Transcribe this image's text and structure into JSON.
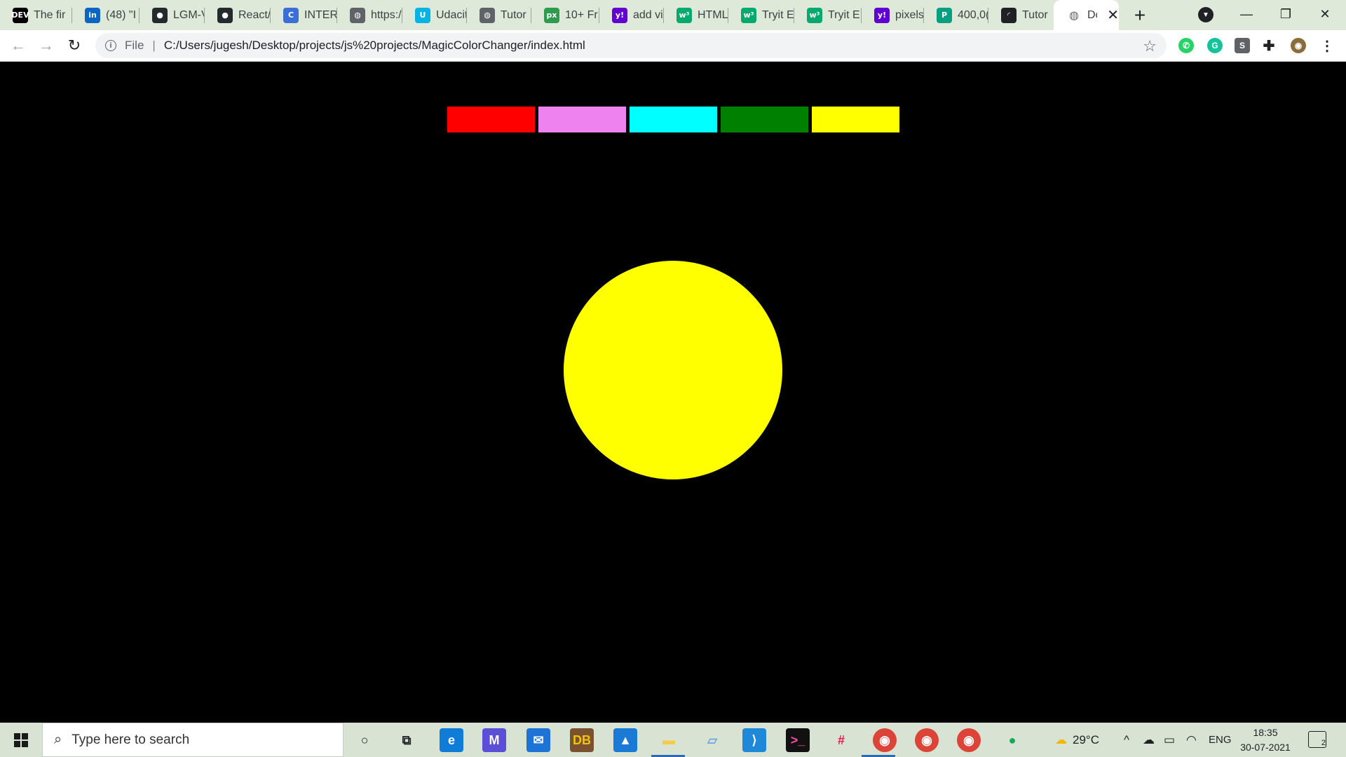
{
  "browser": {
    "tabs": [
      {
        "label": "The fir",
        "icon": "dev-icon",
        "favicon_text": "DEV",
        "favicon_color": "#000000"
      },
      {
        "label": "(48) \"I",
        "icon": "linkedin-icon",
        "favicon_text": "in",
        "favicon_color": "#0a66c2"
      },
      {
        "label": "LGM-V",
        "icon": "github-icon",
        "favicon_text": "●",
        "favicon_color": "#24292e"
      },
      {
        "label": "React/",
        "icon": "github-icon",
        "favicon_text": "●",
        "favicon_color": "#24292e"
      },
      {
        "label": "INTER",
        "icon": "c-icon",
        "favicon_text": "C",
        "favicon_color": "#3b6fd6"
      },
      {
        "label": "https:/",
        "icon": "globe-icon",
        "favicon_text": "◍",
        "favicon_color": "#5f6368"
      },
      {
        "label": "Udacit",
        "icon": "udacity-icon",
        "favicon_text": "U",
        "favicon_color": "#02b3e4"
      },
      {
        "label": "Tutor",
        "icon": "globe-icon",
        "favicon_text": "◍",
        "favicon_color": "#5f6368"
      },
      {
        "label": "10+ Fr",
        "icon": "px-icon",
        "favicon_text": "px",
        "favicon_color": "#2e9b4f"
      },
      {
        "label": "add vi",
        "icon": "yahoo-icon",
        "favicon_text": "y!",
        "favicon_color": "#6001d2"
      },
      {
        "label": "HTML",
        "icon": "w3schools-icon",
        "favicon_text": "w³",
        "favicon_color": "#04aa6d"
      },
      {
        "label": "Tryit E",
        "icon": "w3schools-icon",
        "favicon_text": "w³",
        "favicon_color": "#04aa6d"
      },
      {
        "label": "Tryit E",
        "icon": "w3schools-icon",
        "favicon_text": "w³",
        "favicon_color": "#04aa6d"
      },
      {
        "label": "pixels",
        "icon": "yahoo-icon",
        "favicon_text": "y!",
        "favicon_color": "#6001d2"
      },
      {
        "label": "400,0(",
        "icon": "pexels-icon",
        "favicon_text": "P",
        "favicon_color": "#05a081"
      },
      {
        "label": "Tutor",
        "icon": "loading-icon",
        "favicon_text": "◜",
        "favicon_color": "#202124"
      }
    ],
    "active_tab": {
      "label": "Dc",
      "icon": "globe-icon",
      "close": "✕"
    },
    "new_tab": "+",
    "window_controls": {
      "minimize": "—",
      "restore": "❐",
      "close": "✕"
    },
    "address": {
      "scheme_label": "File",
      "divider": "|",
      "url": "C:/Users/jugesh/Desktop/projects/js%20projects/MagicColorChanger/index.html",
      "info_glyph": "i",
      "bookmark": "☆"
    },
    "nav": {
      "back": "←",
      "forward": "→",
      "reload": "↻"
    },
    "extensions": [
      {
        "name": "whatsapp-icon",
        "glyph": "✆",
        "color": "#25d366"
      },
      {
        "name": "grammarly-icon",
        "glyph": "G",
        "color": "#15c39a"
      },
      {
        "name": "s-extension-icon",
        "glyph": "S",
        "color": "#5f6368"
      },
      {
        "name": "puzzle-icon",
        "glyph": "✚",
        "color": "#202124"
      },
      {
        "name": "avatar",
        "glyph": "◉",
        "color": "#8a6d3b"
      },
      {
        "name": "more-icon",
        "glyph": "⋮",
        "color": "#202124"
      }
    ]
  },
  "page": {
    "background": "#000000",
    "swatches": [
      {
        "name": "red",
        "color": "#ff0000"
      },
      {
        "name": "violet",
        "color": "#ee82ee"
      },
      {
        "name": "cyan",
        "color": "#00ffff"
      },
      {
        "name": "green",
        "color": "#008000"
      },
      {
        "name": "yellow",
        "color": "#ffff00"
      }
    ],
    "circle_color": "#ffff00"
  },
  "taskbar": {
    "search_placeholder": "Type here to search",
    "apps": [
      {
        "name": "cortana-icon",
        "glyph": "○",
        "color": "#202124",
        "bg": "transparent"
      },
      {
        "name": "task-view-icon",
        "glyph": "⧉",
        "color": "#202124",
        "bg": "transparent"
      },
      {
        "name": "edge-icon",
        "glyph": "e",
        "color": "#ffffff",
        "bg": "#0f7cd8"
      },
      {
        "name": "vs-icon",
        "glyph": "M",
        "color": "#ffffff",
        "bg": "#5b4fd8"
      },
      {
        "name": "mail-icon",
        "glyph": "✉",
        "color": "#ffffff",
        "bg": "#1e73d6"
      },
      {
        "name": "dosbox-icon",
        "glyph": "DB",
        "color": "#f1c40f",
        "bg": "#7a5230"
      },
      {
        "name": "photos-icon",
        "glyph": "▲",
        "color": "#ffffff",
        "bg": "#1b7ad6"
      },
      {
        "name": "file-explorer-icon",
        "glyph": "▬",
        "color": "#f7c948",
        "bg": "transparent"
      },
      {
        "name": "notepad-icon",
        "glyph": "▱",
        "color": "#6fa8dc",
        "bg": "transparent"
      },
      {
        "name": "vscode-icon",
        "glyph": "⟩",
        "color": "#ffffff",
        "bg": "#1f88d8"
      },
      {
        "name": "terminal-icon",
        "glyph": ">_",
        "color": "#ff4fa0",
        "bg": "#111111"
      },
      {
        "name": "slack-icon",
        "glyph": "#",
        "color": "#e01e5a",
        "bg": "transparent"
      },
      {
        "name": "chrome-profile-icon",
        "glyph": "◉",
        "color": "#ffffff",
        "bg": "#db4437"
      },
      {
        "name": "chrome-icon",
        "glyph": "◉",
        "color": "#ffffff",
        "bg": "#db4437"
      },
      {
        "name": "chrome-icon-2",
        "glyph": "◉",
        "color": "#ffffff",
        "bg": "#db4437"
      },
      {
        "name": "mongodb-icon",
        "glyph": "●",
        "color": "#13aa52",
        "bg": "transparent"
      }
    ],
    "weather": "29°C",
    "tray_chevron": "^",
    "language": "ENG",
    "time": "18:35",
    "date": "30-07-2021",
    "notifications": "2"
  }
}
